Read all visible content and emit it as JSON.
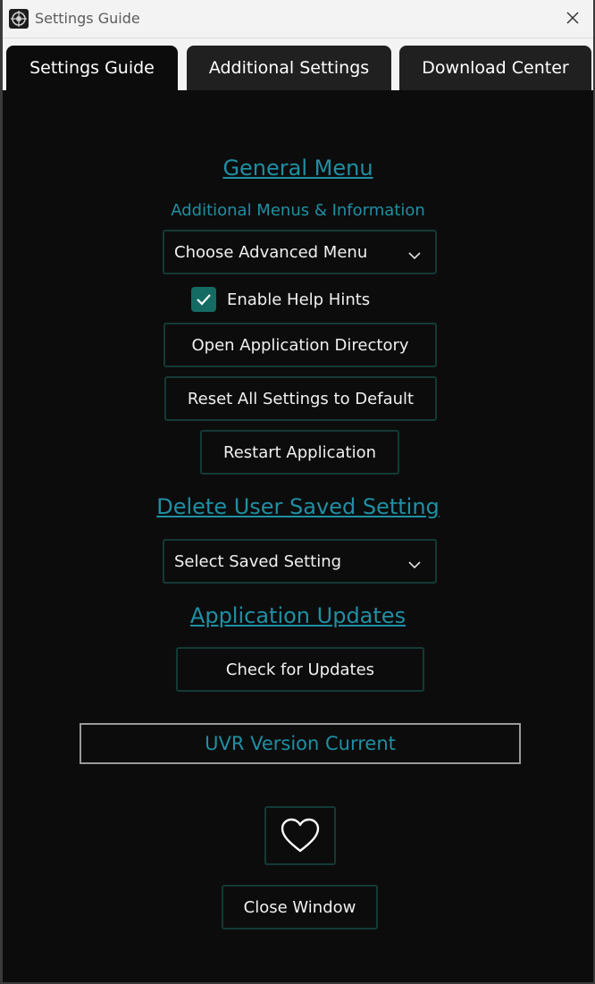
{
  "window": {
    "title": "Settings Guide",
    "close_glyph": "✕"
  },
  "tabs": [
    {
      "label": "Settings Guide",
      "active": true
    },
    {
      "label": "Additional Settings",
      "active": false
    },
    {
      "label": "Download Center",
      "active": false
    }
  ],
  "general": {
    "title": "General Menu",
    "subtitle": "Additional Menus & Information",
    "advanced_menu_dropdown": {
      "value": "Choose Advanced Menu"
    },
    "help_hints": {
      "label": "Enable Help Hints",
      "checked": true
    },
    "open_dir_label": "Open Application Directory",
    "reset_label": "Reset All Settings to Default",
    "restart_label": "Restart Application"
  },
  "delete_saved": {
    "title": "Delete User Saved Setting",
    "dropdown": {
      "value": "Select Saved Setting"
    }
  },
  "updates": {
    "title": "Application Updates",
    "check_label": "Check for Updates",
    "version_status": "UVR Version Current"
  },
  "footer": {
    "heart_icon": "heart-icon",
    "close_window_label": "Close Window"
  },
  "colors": {
    "background": "#0c0c0c",
    "accent": "#1f8fa3",
    "button_border": "#143a36",
    "checkbox": "#146b63"
  }
}
